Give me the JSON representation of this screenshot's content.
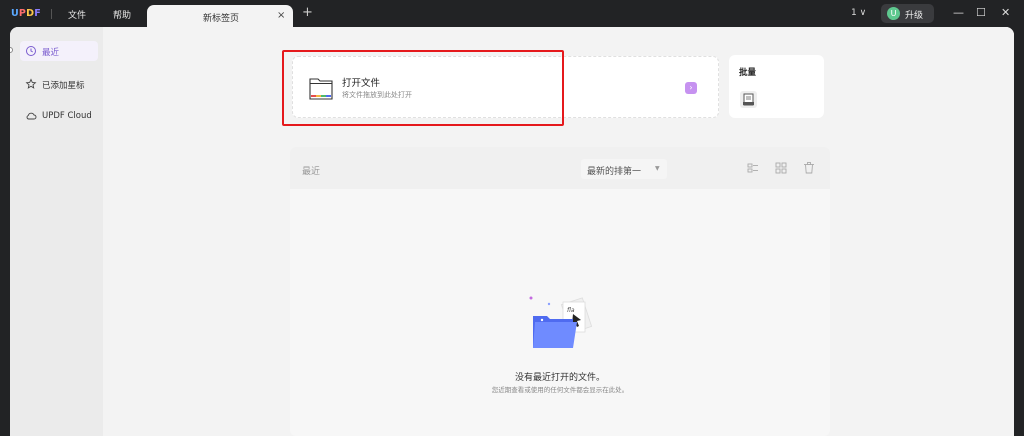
{
  "titlebar": {
    "logo": "UPDF",
    "menu": [
      "文件",
      "帮助"
    ],
    "tab_label": "新标签页",
    "tab_close": "×",
    "new_tab": "+",
    "version": "1 ∨",
    "avatar_letter": "U",
    "upgrade_label": "升级",
    "window_buttons": [
      "—",
      "☐",
      "✕"
    ]
  },
  "sidebar": {
    "items": [
      {
        "label": "最近",
        "icon": "clock-icon",
        "active": true
      },
      {
        "label": "已添加星标",
        "icon": "star-icon",
        "active": false
      },
      {
        "label": "UPDF Cloud",
        "icon": "cloud-icon",
        "active": false
      }
    ]
  },
  "open_card": {
    "title": "打开文件",
    "subtitle": "将文件拖放到此处打开",
    "arrow": "›"
  },
  "batch_card": {
    "title": "批量"
  },
  "recent": {
    "title": "最近",
    "sort_label": "最新的排第一",
    "sort_caret": "▼",
    "empty_title": "没有最近打开的文件。",
    "empty_subtitle": "您近期查看或使用的任何文件都会显示在此处。"
  },
  "colors": {
    "accent": "#7a5ccf",
    "highlight": "#e5191c",
    "arrow_bg": "#c692f0",
    "folder_blue": "#4f6bf0"
  }
}
